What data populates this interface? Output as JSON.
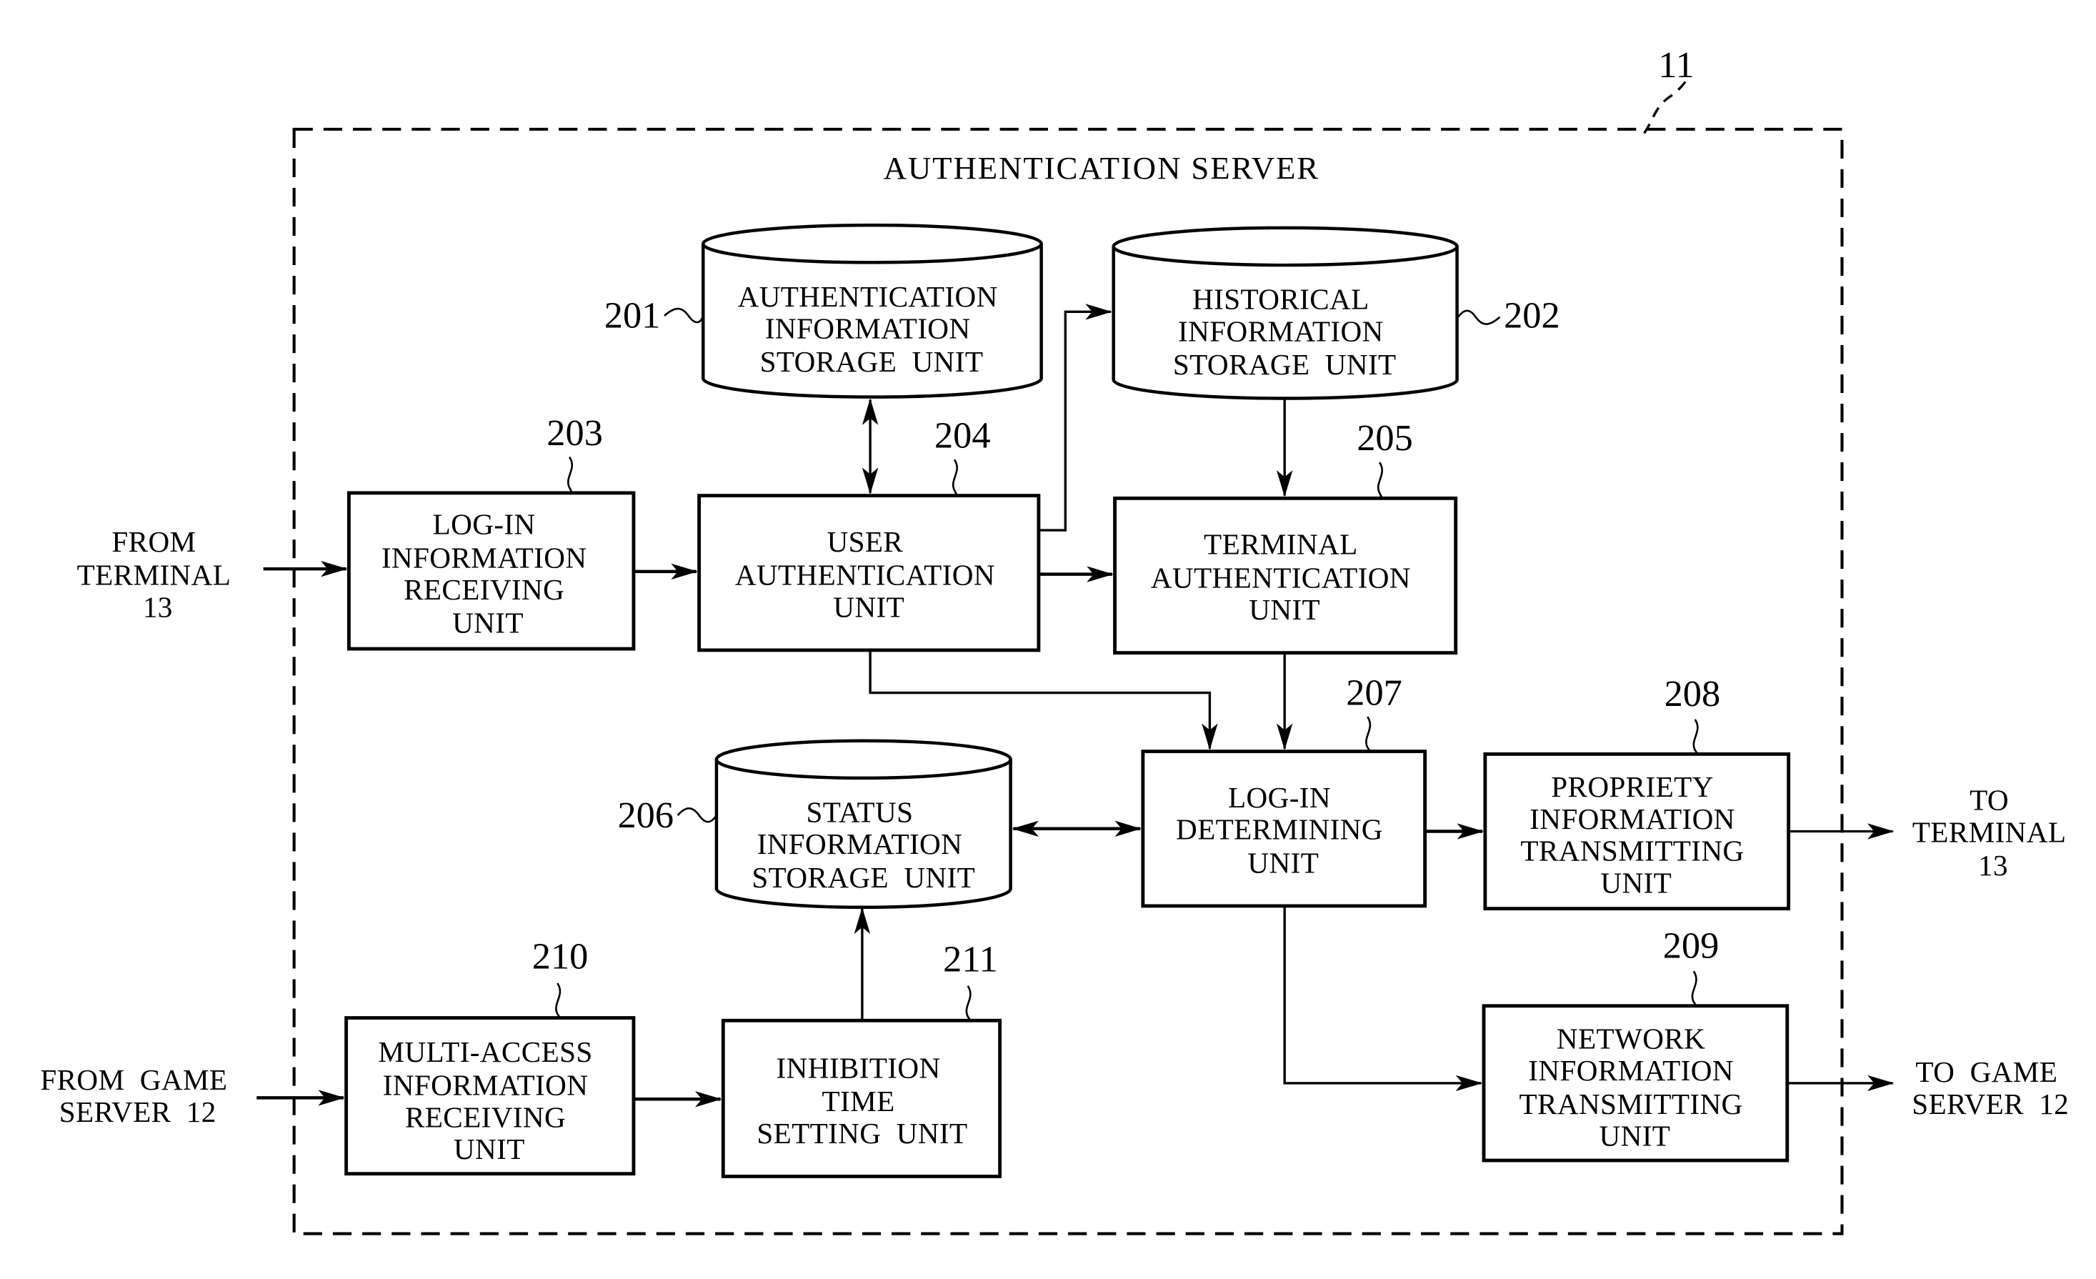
{
  "figure": {
    "reference": "11",
    "title": "AUTHENTICATION SERVER",
    "line_color": "#000000",
    "background": "#ffffff"
  },
  "units": {
    "u201": {
      "ref": "201",
      "shape": "cylinder",
      "lines": [
        "AUTHENTICATION",
        "INFORMATION",
        "STORAGE  UNIT"
      ]
    },
    "u202": {
      "ref": "202",
      "shape": "cylinder",
      "lines": [
        "HISTORICAL",
        "INFORMATION",
        "STORAGE  UNIT"
      ]
    },
    "u203": {
      "ref": "203",
      "shape": "box",
      "lines": [
        "LOG-IN",
        "INFORMATION",
        "RECEIVING",
        "UNIT"
      ]
    },
    "u204": {
      "ref": "204",
      "shape": "box",
      "lines": [
        "USER",
        "AUTHENTICATION",
        "UNIT"
      ]
    },
    "u205": {
      "ref": "205",
      "shape": "box",
      "lines": [
        "TERMINAL",
        "AUTHENTICATION",
        "UNIT"
      ]
    },
    "u206": {
      "ref": "206",
      "shape": "cylinder",
      "lines": [
        "STATUS",
        "INFORMATION",
        "STORAGE  UNIT"
      ]
    },
    "u207": {
      "ref": "207",
      "shape": "box",
      "lines": [
        "LOG-IN",
        "DETERMINING",
        "UNIT"
      ]
    },
    "u208": {
      "ref": "208",
      "shape": "box",
      "lines": [
        "PROPRIETY",
        "INFORMATION",
        "TRANSMITTING",
        "UNIT"
      ]
    },
    "u209": {
      "ref": "209",
      "shape": "box",
      "lines": [
        "NETWORK",
        "INFORMATION",
        "TRANSMITTING",
        "UNIT"
      ]
    },
    "u210": {
      "ref": "210",
      "shape": "box",
      "lines": [
        "MULTI-ACCESS",
        "INFORMATION",
        "RECEIVING",
        "UNIT"
      ]
    },
    "u211": {
      "ref": "211",
      "shape": "box",
      "lines": [
        "INHIBITION",
        "TIME",
        "SETTING  UNIT"
      ]
    }
  },
  "external": {
    "from_terminal": [
      "FROM",
      "TERMINAL",
      "13"
    ],
    "from_game_server": [
      "FROM  GAME",
      "SERVER  12"
    ],
    "to_terminal": [
      "TO",
      "TERMINAL",
      "13"
    ],
    "to_game_server": [
      "TO  GAME",
      "SERVER  12"
    ]
  },
  "connections": [
    {
      "from": "FROM TERMINAL 13",
      "to": "203",
      "type": "arrow"
    },
    {
      "from": "203",
      "to": "204",
      "type": "arrow"
    },
    {
      "from": "204",
      "to": "201",
      "type": "bidirectional"
    },
    {
      "from": "204",
      "to": "202",
      "type": "arrow"
    },
    {
      "from": "204",
      "to": "205",
      "type": "arrow"
    },
    {
      "from": "202",
      "to": "205",
      "type": "arrow"
    },
    {
      "from": "204",
      "to": "207",
      "type": "arrow"
    },
    {
      "from": "205",
      "to": "207",
      "type": "arrow"
    },
    {
      "from": "206",
      "to": "207",
      "type": "bidirectional"
    },
    {
      "from": "207",
      "to": "208",
      "type": "arrow"
    },
    {
      "from": "207",
      "to": "209",
      "type": "arrow"
    },
    {
      "from": "208",
      "to": "TO TERMINAL 13",
      "type": "arrow"
    },
    {
      "from": "209",
      "to": "TO GAME SERVER 12",
      "type": "arrow"
    },
    {
      "from": "FROM GAME SERVER 12",
      "to": "210",
      "type": "arrow"
    },
    {
      "from": "210",
      "to": "211",
      "type": "arrow"
    },
    {
      "from": "211",
      "to": "206",
      "type": "arrow"
    }
  ]
}
